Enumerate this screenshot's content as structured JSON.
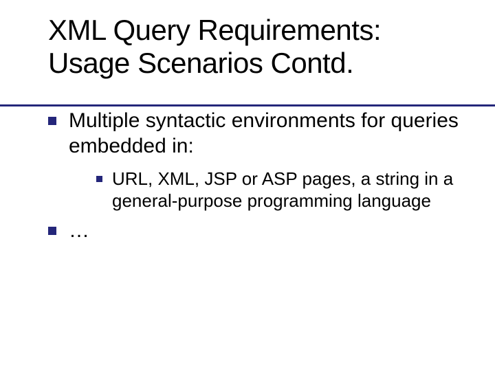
{
  "title_line1": "XML Query Requirements:",
  "title_line2": "Usage Scenarios Contd.",
  "bullets": {
    "item1": "Multiple syntactic environments for queries embedded in:",
    "item1_sub1": "URL, XML, JSP or ASP pages, a string in a general-purpose programming language",
    "item2": "…"
  },
  "colors": {
    "accent": "#24267a"
  }
}
